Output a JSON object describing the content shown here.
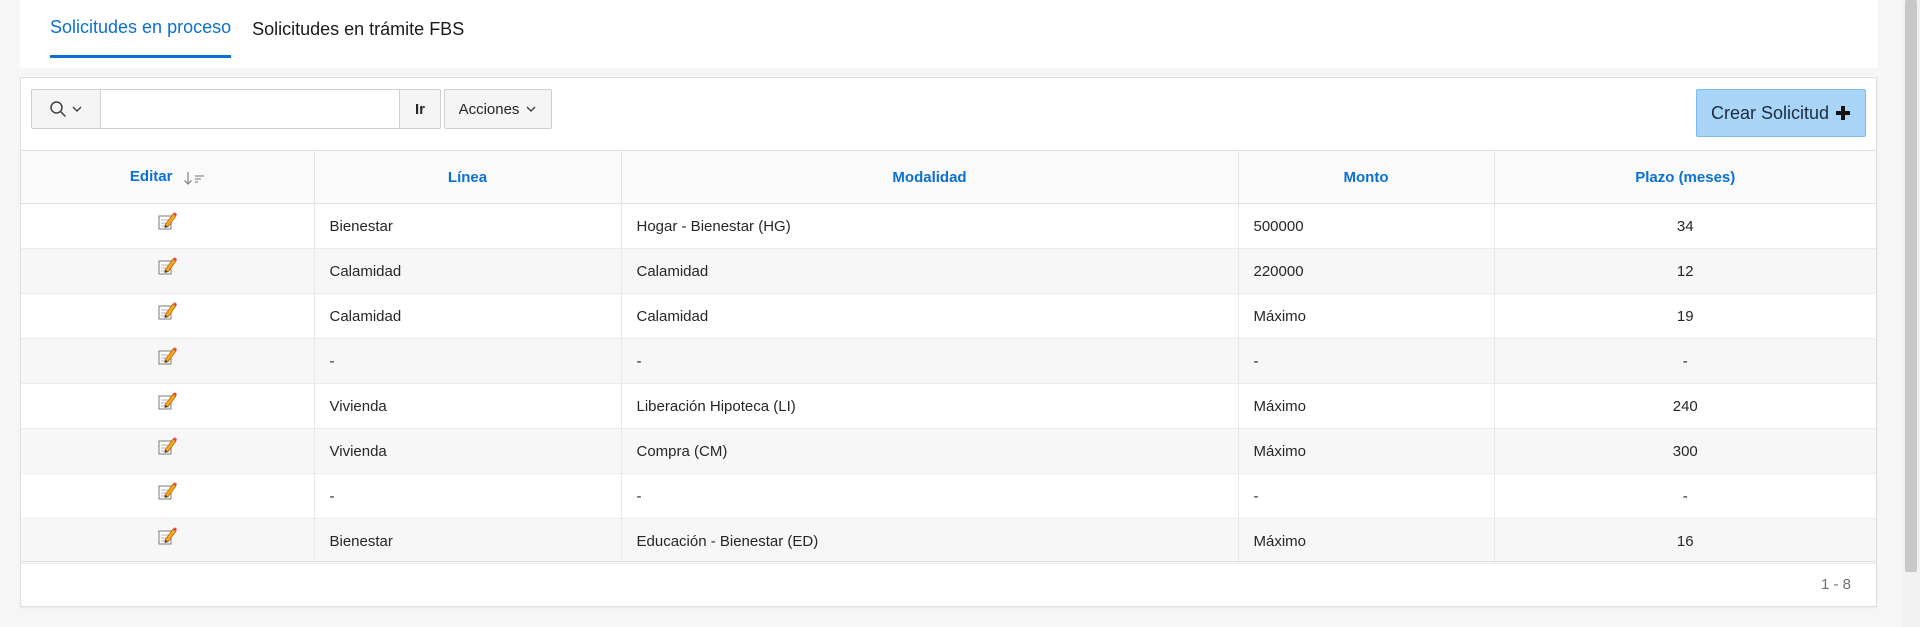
{
  "tabs": [
    {
      "label": "Solicitudes en proceso",
      "active": true
    },
    {
      "label": "Solicitudes en trámite FBS",
      "active": false
    }
  ],
  "toolbar": {
    "search_value": "",
    "go_label": "Ir",
    "actions_label": "Acciones",
    "create_label": "Crear Solicitud",
    "create_icon": "plus-icon"
  },
  "table": {
    "columns": [
      "Editar",
      "Línea",
      "Modalidad",
      "Monto",
      "Plazo (meses)"
    ],
    "sorted_column": "Editar",
    "rows": [
      {
        "linea": "Bienestar",
        "modalidad": "Hogar - Bienestar (HG)",
        "monto": "500000",
        "plazo": "34"
      },
      {
        "linea": "Calamidad",
        "modalidad": "Calamidad",
        "monto": "220000",
        "plazo": "12"
      },
      {
        "linea": "Calamidad",
        "modalidad": "Calamidad",
        "monto": "Máximo",
        "plazo": "19"
      },
      {
        "linea": "-",
        "modalidad": "-",
        "monto": "-",
        "plazo": "-"
      },
      {
        "linea": "Vivienda",
        "modalidad": "Liberación Hipoteca (LI)",
        "monto": "Máximo",
        "plazo": "240"
      },
      {
        "linea": "Vivienda",
        "modalidad": "Compra (CM)",
        "monto": "Máximo",
        "plazo": "300"
      },
      {
        "linea": "-",
        "modalidad": "-",
        "monto": "-",
        "plazo": "-"
      },
      {
        "linea": "Bienestar",
        "modalidad": "Educación - Bienestar (ED)",
        "monto": "Máximo",
        "plazo": "16"
      }
    ]
  },
  "pagination": {
    "range_text": "1 - 8"
  },
  "colors": {
    "accent": "#0a70d3",
    "create_button": "#a9d5f8"
  }
}
